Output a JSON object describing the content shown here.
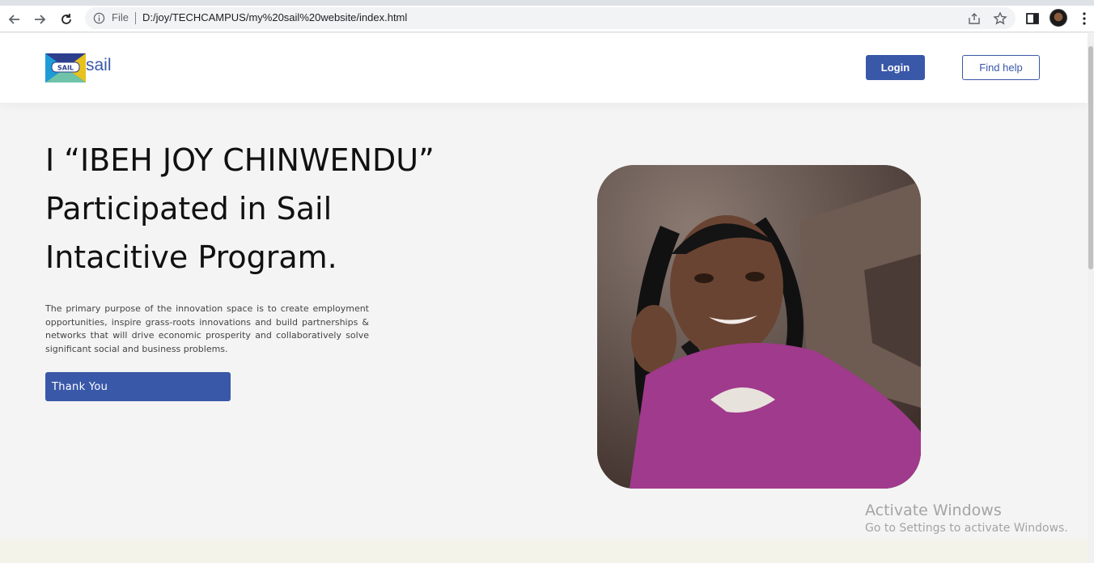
{
  "browser": {
    "file_label": "File",
    "url": "D:/joy/TECHCAMPUS/my%20sail%20website/index.html",
    "icons": [
      "back-arrow-icon",
      "forward-arrow-icon",
      "reload-icon",
      "info-icon",
      "share-icon",
      "star-icon",
      "side-panel-icon",
      "more-vert-icon"
    ]
  },
  "header": {
    "logo_badge": "SAIL",
    "logo_text": "sail",
    "login_label": "Login",
    "help_label": "Find help"
  },
  "hero": {
    "title_line1": "I “IBEH JOY CHINWENDU”",
    "title_line2": "Participated in Sail",
    "title_line3": "Intacitive Program.",
    "description": "The primary purpose of the innovation space is to create employment opportunities, inspire grass-roots innovations and build partnerships & networks that will drive economic prosperity and collaboratively solve significant social and business problems.",
    "button_label": "Thank You"
  },
  "watermark": {
    "title": "Activate Windows",
    "subtitle": "Go to Settings to activate Windows."
  },
  "colors": {
    "brand": "#3a58a8",
    "page_bg": "#f4f4f4",
    "photo_shirt": "#a03a8c"
  }
}
